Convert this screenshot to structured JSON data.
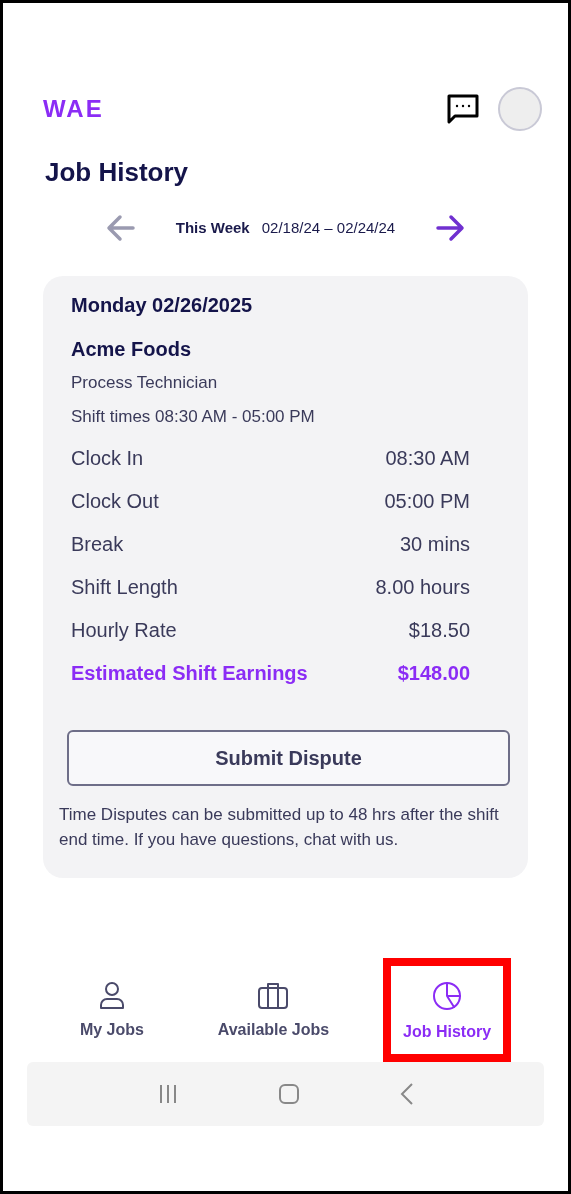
{
  "header": {
    "logo": "WAE"
  },
  "title": "Job History",
  "week_nav": {
    "label": "This Week",
    "range": "02/18/24 – 02/24/24",
    "prev_disabled": true,
    "next_disabled": false
  },
  "shift_card": {
    "date": "Monday 02/26/2025",
    "employer": "Acme Foods",
    "role": "Process Technician",
    "shift_times": "Shift times 08:30 AM - 05:00 PM",
    "rows": [
      {
        "label": "Clock In",
        "value": "08:30 AM",
        "kind": "plain"
      },
      {
        "label": "Clock Out",
        "value": "05:00 PM",
        "kind": "plain"
      },
      {
        "label": "Break",
        "value": "30 mins",
        "kind": "plain"
      },
      {
        "label": "Shift Length",
        "value": "8.00 hours",
        "kind": "plain"
      },
      {
        "label": "Hourly Rate",
        "value": "$18.50",
        "kind": "plain"
      },
      {
        "label": "Estimated Shift Earnings",
        "value": "$148.00",
        "kind": "total"
      }
    ],
    "button": "Submit Dispute",
    "note": "Time Disputes can be submitted up to 48 hrs after the shift end time. If you have questions, chat with us."
  },
  "bottom_nav": [
    {
      "label": "My Jobs",
      "kind": "person",
      "selected": false,
      "highlighted": false
    },
    {
      "label": "Available Jobs",
      "kind": "briefcase",
      "selected": false,
      "highlighted": false
    },
    {
      "label": "Job History",
      "kind": "pie",
      "selected": true,
      "highlighted": true
    }
  ]
}
